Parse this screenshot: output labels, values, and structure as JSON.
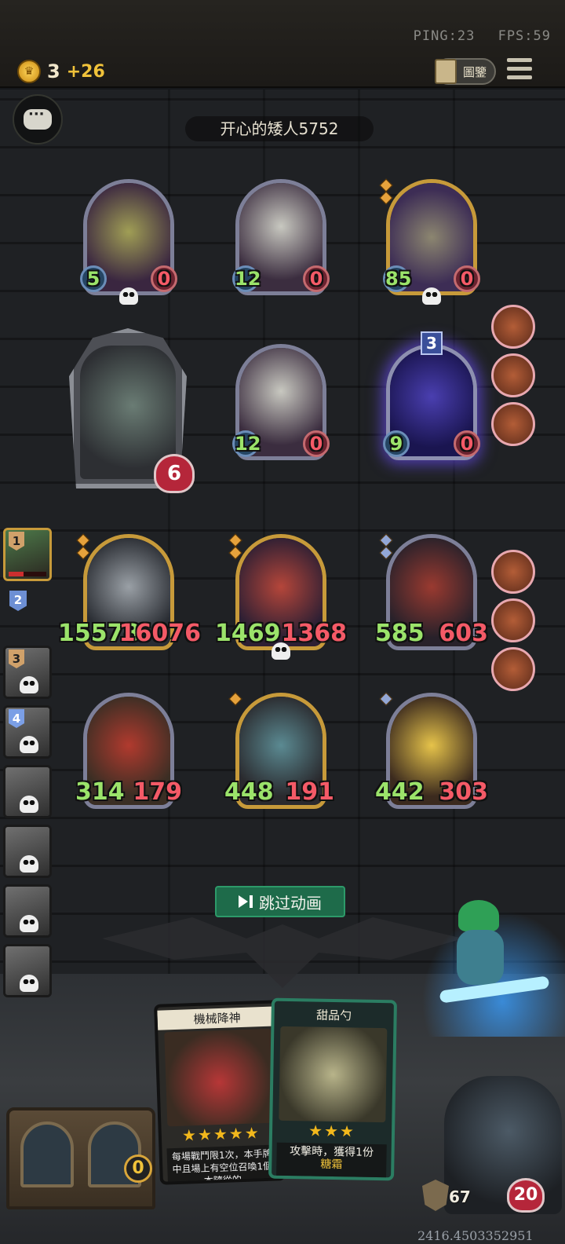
{
  "hud": {
    "ping": "PING:23",
    "fps": "FPS:59",
    "gold": "3",
    "gold_gain": "+26",
    "codex_label": "圖鑒"
  },
  "opponent": {
    "name": "开心的矮人5752",
    "hero_health": "6"
  },
  "opponent_board": {
    "row1": [
      {
        "atk": "5",
        "hp": "0",
        "dead": true
      },
      {
        "atk": "12",
        "hp": "0",
        "dead": false
      },
      {
        "atk": "85",
        "hp": "0",
        "dead": true
      }
    ],
    "row2": [
      {
        "atk": "12",
        "hp": "0"
      },
      {
        "atk": "9",
        "hp": "0",
        "level": "3"
      }
    ]
  },
  "player_board": {
    "row1": [
      {
        "atk": "15578",
        "hp": "16076"
      },
      {
        "atk": "1469",
        "hp": "1368",
        "dead": true
      },
      {
        "atk": "585",
        "hp": "603"
      }
    ],
    "row2": [
      {
        "atk": "314",
        "hp": "179"
      },
      {
        "atk": "448",
        "hp": "191"
      },
      {
        "atk": "442",
        "hp": "303"
      }
    ]
  },
  "standings": {
    "ranks": [
      "1",
      "2",
      "3",
      "4"
    ],
    "self_hp_fraction": 0.4
  },
  "controls": {
    "skip_label": "跳过动画"
  },
  "hand": [
    {
      "name": "機械降神",
      "stars": "★★★★★",
      "desc": "每場戰鬥限1次，本手牌中且場上有空位召喚1個本隨從的"
    },
    {
      "name": "甜品勺",
      "stars": "★★★",
      "desc": "攻擊時，獲得1份",
      "desc_highlight": "糖霜"
    }
  ],
  "tavern": {
    "count": "0"
  },
  "player": {
    "armor": "67",
    "health": "20"
  },
  "debug_value": "2416.4503352951",
  "colors": {
    "attack": "#9be36a",
    "health": "#f45a67",
    "gold": "#f0c23a",
    "skip_button": "#1e6b4a"
  }
}
